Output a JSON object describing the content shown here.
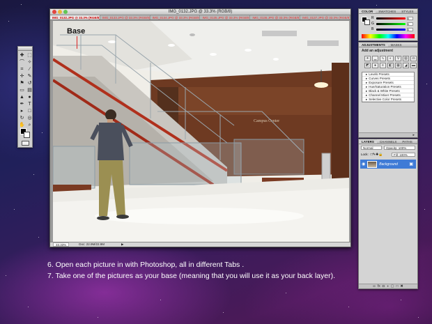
{
  "document": {
    "title": "IMG_0132.JPG @ 33.3% (RGB/8)",
    "tabs": [
      "IMG_0132.JPG @ 33.3% (RGB/8)",
      "IMG_0133.JPG @ 33.3% (RGB/8)",
      "IMG_0134.JPG @ 33.3% (RGB/8)",
      "IMG_0135.JPG @ 33.3% (RGB/8)",
      "IMG_0136.JPG @ 33.3% (RGB/8)",
      "IMG_0137.JPG @ 33.3% (RGB/8)"
    ],
    "annotation": "Base",
    "status": {
      "zoom": "33.33%",
      "doc": "Doc: 22.9M/22.9M"
    },
    "wall_sign": "Campus Center"
  },
  "color_panel": {
    "tabs": [
      "COLOR",
      "SWATCHES",
      "STYLES"
    ],
    "sliders": [
      {
        "label": "R",
        "value": "0"
      },
      {
        "label": "G",
        "value": "0"
      },
      {
        "label": "B",
        "value": "0"
      }
    ]
  },
  "adjustments_panel": {
    "tabs": [
      "ADJUSTMENTS",
      "MASKS"
    ],
    "heading": "Add an adjustment",
    "presets": [
      "Levels Presets",
      "Curves Presets",
      "Exposure Presets",
      "Hue/Saturation Presets",
      "Black & White Presets",
      "Channel Mixer Presets",
      "Selective Color Presets"
    ]
  },
  "layers_panel": {
    "tabs": [
      "LAYERS",
      "CHANNELS",
      "PATHS"
    ],
    "blend_mode": "Normal",
    "opacity_label": "Opacity: 100%",
    "lock_label": "Lock:",
    "fill_label": "Fill: 100%",
    "layer_name": "Background"
  },
  "captions": {
    "line1": "6. Open each picture in with Photoshop, all in different Tabs .",
    "line2": "7. Take one of the pictures as your base (meaning that you will use it as your back layer)."
  }
}
